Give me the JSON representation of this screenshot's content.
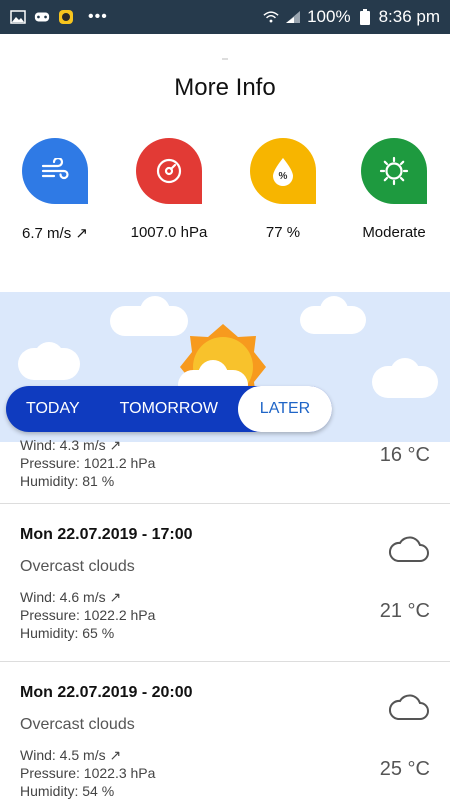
{
  "status_bar": {
    "battery": "100%",
    "time": "8:36 pm"
  },
  "page": {
    "title": "More Info"
  },
  "metrics": [
    {
      "icon": "wind-icon",
      "value": "6.7 m/s ↗",
      "color": "#2f7ae5"
    },
    {
      "icon": "gauge-icon",
      "value": "1007.0 hPa",
      "color": "#e23a35"
    },
    {
      "icon": "humidity-drop-icon",
      "value": "77 %",
      "color": "#f7b500"
    },
    {
      "icon": "sun-icon",
      "value": "Moderate",
      "color": "#1e9a3f"
    }
  ],
  "tabs": [
    "TODAY",
    "TOMORROW",
    "LATER"
  ],
  "forecast": [
    {
      "wind": "Wind: 4.3 m/s ↗",
      "pressure": "Pressure: 1021.2 hPa",
      "humidity": "Humidity: 81 %",
      "temp": "16 °C"
    },
    {
      "date": "Mon 22.07.2019 - 17:00",
      "desc": "Overcast clouds",
      "wind": "Wind: 4.6 m/s ↗",
      "pressure": "Pressure: 1022.2 hPa",
      "humidity": "Humidity: 65 %",
      "temp": "21 °C"
    },
    {
      "date": "Mon 22.07.2019 - 20:00",
      "desc": "Overcast clouds",
      "wind": "Wind: 4.5 m/s ↗",
      "pressure": "Pressure: 1022.3 hPa",
      "humidity": "Humidity: 54 %",
      "temp": "25 °C"
    }
  ],
  "colors": {
    "statusbar": "#263a4c",
    "banner_sky": "#dbe8fb",
    "tabbar": "#0f3bbf",
    "tab_active_text": "#1f65c7"
  }
}
